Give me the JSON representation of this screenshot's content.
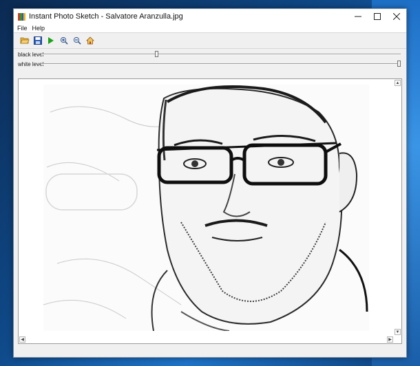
{
  "window": {
    "title": "Instant Photo Sketch - Salvatore Aranzulla.jpg"
  },
  "menu": [
    "File",
    "Help"
  ],
  "toolbar": [
    {
      "icon": "open-folder-icon"
    },
    {
      "icon": "save-icon"
    },
    {
      "icon": "play-icon"
    },
    {
      "icon": "zoom-in-icon"
    },
    {
      "icon": "zoom-out-icon"
    },
    {
      "icon": "home-icon"
    }
  ],
  "sliders": {
    "black": {
      "label": "black level",
      "value": 0.32
    },
    "white": {
      "label": "white level",
      "value": 1.0
    }
  },
  "colors": {
    "accent": "#0f4a8a",
    "play": "#1aa21a",
    "folder": "#e8b33c"
  }
}
